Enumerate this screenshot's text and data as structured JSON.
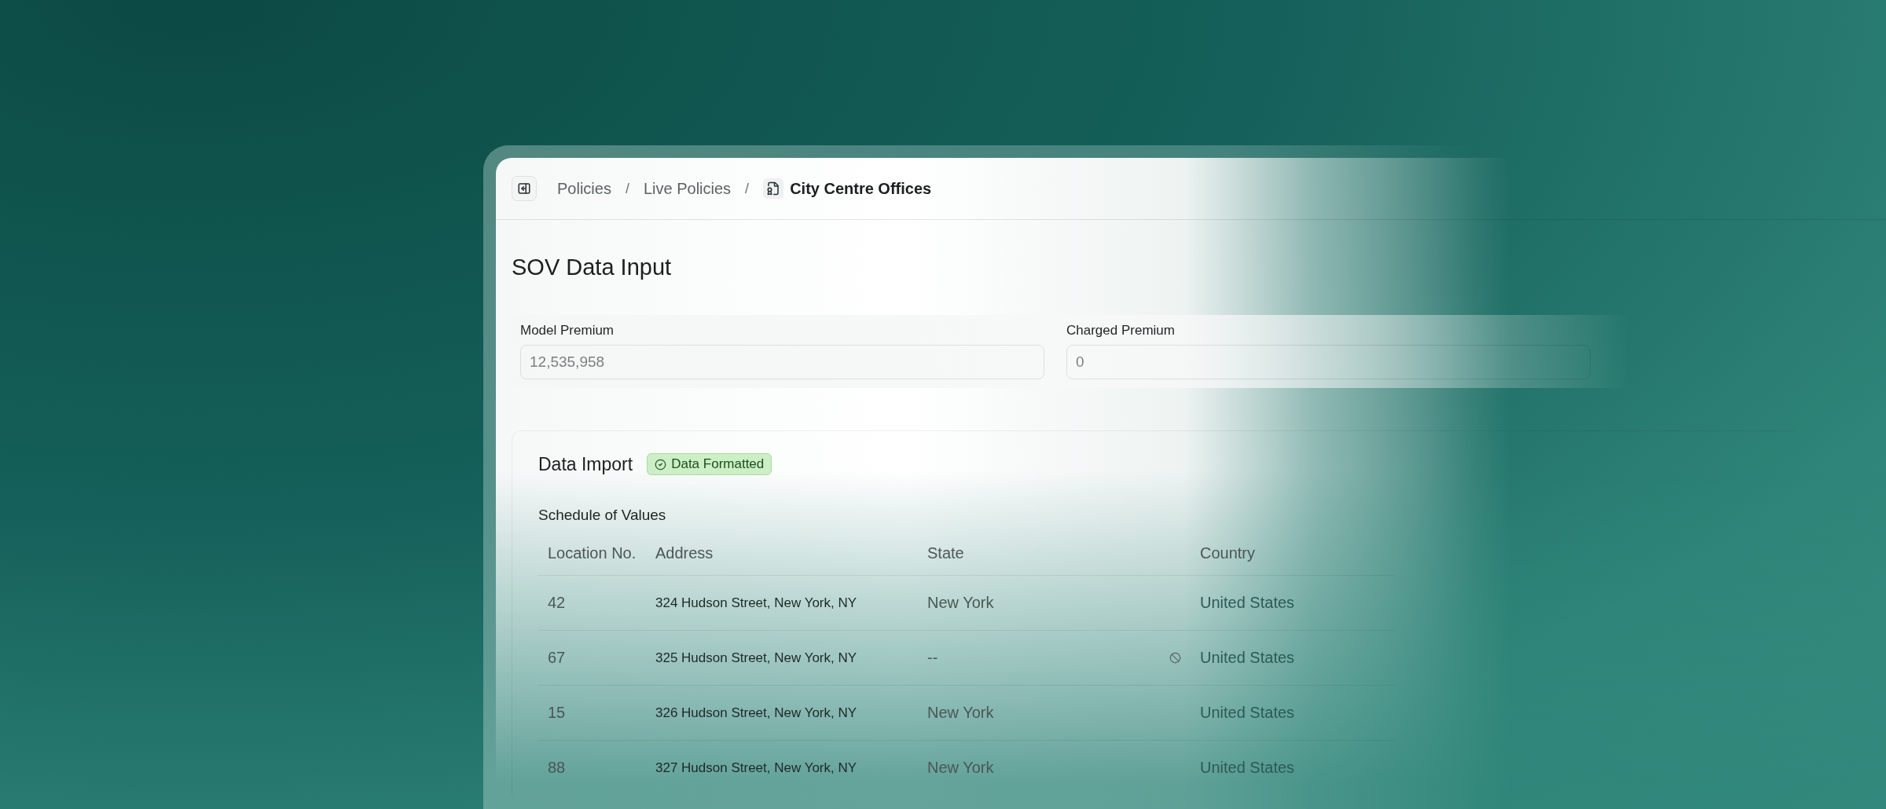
{
  "breadcrumb": {
    "items": [
      {
        "label": "Policies",
        "current": false
      },
      {
        "label": "Live Policies",
        "current": false
      },
      {
        "label": "City Centre Offices",
        "current": true
      }
    ],
    "separator": "/"
  },
  "page_title": "SOV Data Input",
  "premium_fields": [
    {
      "label": "Model Premium",
      "value": "12,535,958"
    },
    {
      "label": "Charged Premium",
      "value": "0"
    }
  ],
  "data_import": {
    "title": "Data Import",
    "badge": "Data Formatted",
    "subtitle": "Schedule of Values",
    "table": {
      "columns": [
        "Location No.",
        "Address",
        "State",
        "Country"
      ],
      "rows": [
        {
          "location_no": "42",
          "address": "324 Hudson Street, New York, NY",
          "state": "New York",
          "state_invalid": false,
          "country": "United States"
        },
        {
          "location_no": "67",
          "address": "325 Hudson Street, New York, NY",
          "state": "--",
          "state_invalid": true,
          "country": "United States"
        },
        {
          "location_no": "15",
          "address": "326 Hudson Street, New York, NY",
          "state": "New York",
          "state_invalid": false,
          "country": "United States"
        },
        {
          "location_no": "88",
          "address": "327 Hudson Street, New York, NY",
          "state": "New York",
          "state_invalid": false,
          "country": "United States"
        }
      ]
    }
  }
}
